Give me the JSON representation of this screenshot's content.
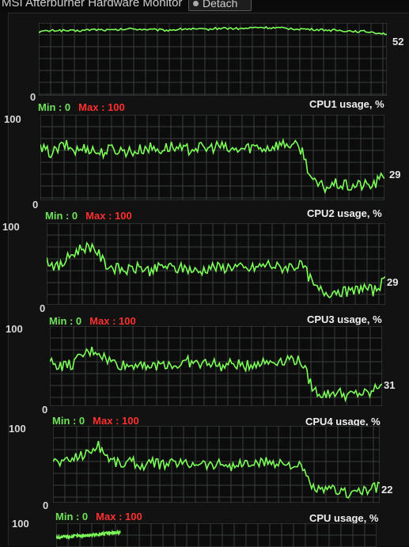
{
  "window": {
    "title": "MSI Afterburner Hardware Monitor",
    "detach_label": "Detach"
  },
  "colors": {
    "line": "#7dff5a",
    "grid": "#3a3f3a",
    "graph_bg": "#0b0c0b",
    "min_label": "#6fe35a",
    "max_label": "#ff3030"
  },
  "graphs": [
    {
      "id": "top",
      "title": "",
      "min_text": "",
      "max_text": "",
      "y_max_label": "",
      "y_min_label": "0",
      "current_value": "52"
    },
    {
      "id": "cpu1",
      "title": "CPU1 usage, %",
      "min_text": "Min : 0",
      "max_text": "Max : 100",
      "y_max_label": "100",
      "y_min_label": "0",
      "current_value": "29"
    },
    {
      "id": "cpu2",
      "title": "CPU2 usage, %",
      "min_text": "Min : 0",
      "max_text": "Max : 100",
      "y_max_label": "100",
      "y_min_label": "0",
      "current_value": "29"
    },
    {
      "id": "cpu3",
      "title": "CPU3 usage, %",
      "min_text": "Min : 0",
      "max_text": "Max : 100",
      "y_max_label": "100",
      "y_min_label": "0",
      "current_value": "31"
    },
    {
      "id": "cpu4",
      "title": "CPU4 usage, %",
      "min_text": "Min : 0",
      "max_text": "Max : 100",
      "y_max_label": "100",
      "y_min_label": "0",
      "current_value": "22"
    },
    {
      "id": "cpu",
      "title": "CPU usage, %",
      "min_text": "Min : 0",
      "max_text": "Max : 100",
      "y_max_label": "100",
      "y_min_label": "",
      "current_value": ""
    }
  ],
  "chart_data": [
    {
      "type": "line",
      "title": "",
      "ylim": [
        0,
        100
      ],
      "series": [
        {
          "values": [
            88,
            90,
            89,
            91,
            90,
            92,
            91,
            90,
            92,
            91,
            93,
            92,
            94,
            93,
            92,
            91,
            90,
            89,
            88,
            85
          ]
        }
      ]
    },
    {
      "type": "line",
      "title": "CPU1 usage, %",
      "ylim": [
        0,
        100
      ],
      "series": [
        {
          "values": [
            60,
            55,
            65,
            58,
            62,
            55,
            60,
            58,
            57,
            62,
            59,
            63,
            58,
            62,
            60,
            64,
            58,
            60,
            63,
            61,
            65,
            66,
            60,
            20,
            15,
            19,
            16,
            18,
            17,
            29
          ]
        }
      ]
    },
    {
      "type": "line",
      "title": "CPU2 usage, %",
      "ylim": [
        0,
        100
      ],
      "series": [
        {
          "values": [
            55,
            45,
            60,
            70,
            72,
            50,
            44,
            42,
            46,
            41,
            48,
            44,
            45,
            40,
            47,
            45,
            48,
            43,
            46,
            50,
            45,
            48,
            47,
            20,
            15,
            18,
            14,
            22,
            17,
            29
          ]
        }
      ]
    },
    {
      "type": "line",
      "title": "CPU3 usage, %",
      "ylim": [
        0,
        100
      ],
      "series": [
        {
          "values": [
            55,
            50,
            52,
            65,
            70,
            58,
            52,
            50,
            55,
            48,
            54,
            50,
            56,
            52,
            55,
            49,
            53,
            50,
            54,
            55,
            57,
            60,
            55,
            20,
            14,
            18,
            13,
            16,
            15,
            31
          ]
        }
      ]
    },
    {
      "type": "line",
      "title": "CPU4 usage, %",
      "ylim": [
        0,
        100
      ],
      "series": [
        {
          "values": [
            55,
            52,
            60,
            64,
            75,
            58,
            50,
            54,
            48,
            52,
            49,
            53,
            50,
            54,
            48,
            52,
            47,
            51,
            50,
            53,
            52,
            50,
            46,
            20,
            14,
            18,
            12,
            16,
            15,
            22
          ]
        }
      ]
    },
    {
      "type": "line",
      "title": "CPU usage, %",
      "ylim": [
        0,
        100
      ],
      "series": [
        {
          "values": [
            40,
            50,
            62
          ]
        }
      ]
    }
  ]
}
